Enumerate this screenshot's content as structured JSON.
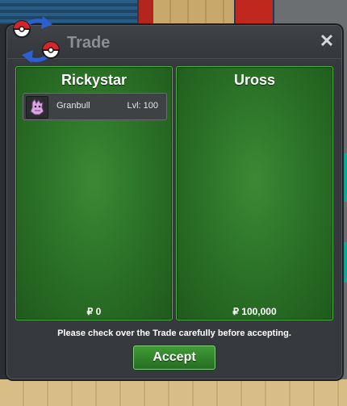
{
  "window": {
    "title": "Trade",
    "close_label": "✕"
  },
  "left_panel": {
    "player": "Rickystar",
    "money": "₽ 0",
    "items": [
      {
        "name": "Granbull",
        "level": "Lvl: 100",
        "icon": "granbull-sprite"
      }
    ]
  },
  "right_panel": {
    "player": "Uross",
    "money": "₽ 100,000",
    "items": []
  },
  "notice": "Please check over the Trade carefully before accepting.",
  "accept_label": "Accept",
  "colors": {
    "panel_green": "#2a6f26",
    "window_bg": "#36393d",
    "button_green": "#2f8529"
  }
}
